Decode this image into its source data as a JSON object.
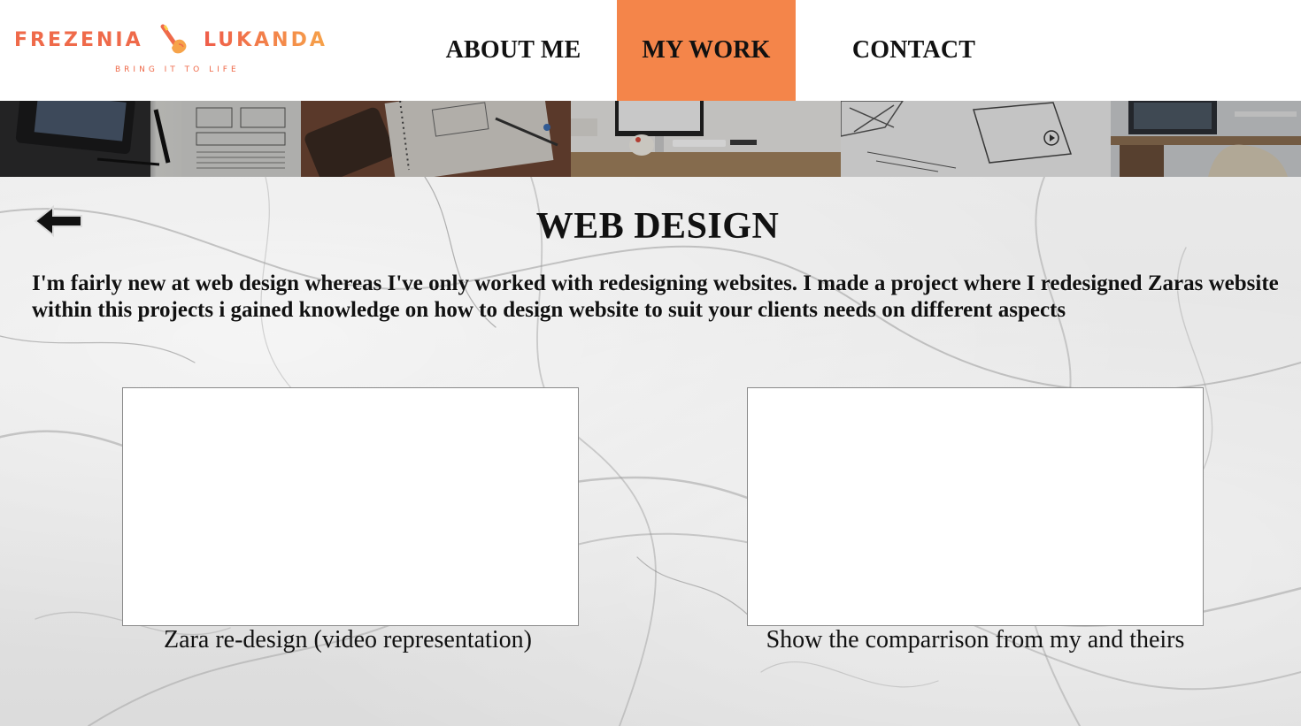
{
  "brand": {
    "first_name": "FREZENIA",
    "last_name": "LUKANDA",
    "tagline": "BRING IT TO LIFE",
    "mark_icon": "pencil-hand-icon",
    "color_primary": "#ef6a4a",
    "color_gradient_end": "#f6a34a"
  },
  "nav": {
    "items": [
      {
        "label": "ABOUT ME",
        "active": false
      },
      {
        "label": "MY WORK",
        "active": true
      },
      {
        "label": "CONTACT",
        "active": false
      }
    ],
    "active_color": "#f4854a"
  },
  "banner": {
    "tiles": [
      "tablet-desk",
      "notebook-wireframe",
      "imac-desk",
      "wireframe-sketch",
      "laptop-chair"
    ]
  },
  "page": {
    "back_icon": "back-arrow-icon",
    "title": "WEB DESIGN",
    "intro": "I'm fairly new at web design whereas I've only worked with redesigning websites. I made a project where I redesigned Zaras website within this projects i gained knowledge on how to design website to suit your clients needs on different aspects"
  },
  "projects": [
    {
      "caption": "Zara re-design (video representation)"
    },
    {
      "caption": "Show the comparrison from my and theirs"
    }
  ]
}
